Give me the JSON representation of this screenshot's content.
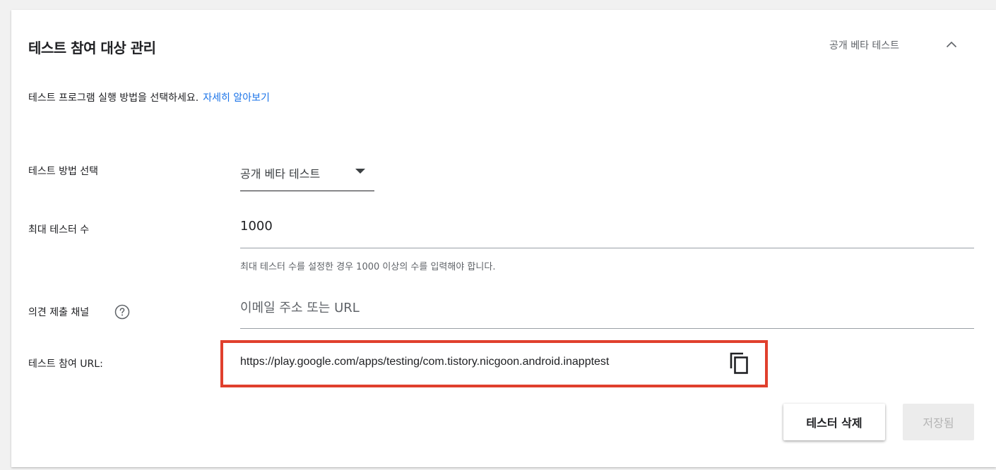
{
  "card": {
    "title": "테스트 참여 대상 관리",
    "status": "공개 베타 테스트"
  },
  "intro": {
    "text": "테스트 프로그램 실행 방법을 선택하세요.",
    "link": "자세히 알아보기"
  },
  "test_method": {
    "label": "테스트 방법 선택",
    "value": "공개 베타 테스트"
  },
  "max_testers": {
    "label": "최대 테스터 수",
    "value": "1000",
    "helper": "최대 테스터 수를 설정한 경우 1000 이상의 수를 입력해야 합니다."
  },
  "feedback": {
    "label": "의견 제출 채널",
    "placeholder": "이메일 주소 또는 URL",
    "value": ""
  },
  "opt_in": {
    "label": "테스트 참여 URL:",
    "url": "https://play.google.com/apps/testing/com.tistory.nicgoon.android.inapptest"
  },
  "actions": {
    "delete_label": "테스터 삭제",
    "save_label": "저장됨"
  },
  "icons": {
    "collapse": "chevron-up-icon",
    "dropdown": "dropdown-arrow-icon",
    "help": "help-circle-icon",
    "copy": "copy-icon"
  },
  "colors": {
    "link": "#1a73e8",
    "highlight_box": "#e0402d",
    "disabled_button": "#ececec"
  }
}
